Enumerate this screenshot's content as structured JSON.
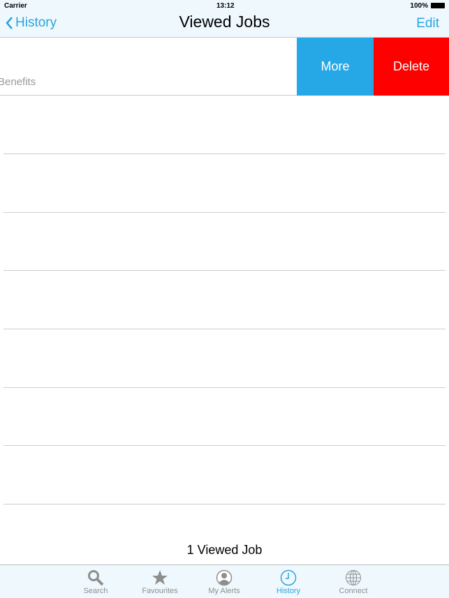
{
  "status": {
    "carrier": "Carrier",
    "time": "13:12",
    "battery": "100%"
  },
  "nav": {
    "back_label": "History",
    "title": "Viewed Jobs",
    "edit_label": "Edit"
  },
  "row": {
    "subtitle": "Benefits",
    "more_label": "More",
    "delete_label": "Delete"
  },
  "colors": {
    "accent": "#2aa3e0",
    "more": "#27a8e6",
    "delete": "#fe0000"
  },
  "footer": {
    "count": "1 Viewed Job"
  },
  "tabs": [
    {
      "label": "Search",
      "icon": "search-icon"
    },
    {
      "label": "Favourites",
      "icon": "star-icon"
    },
    {
      "label": "My Alerts",
      "icon": "user-circle-icon"
    },
    {
      "label": "History",
      "icon": "clock-icon",
      "active": true
    },
    {
      "label": "Connect",
      "icon": "globe-icon"
    }
  ]
}
